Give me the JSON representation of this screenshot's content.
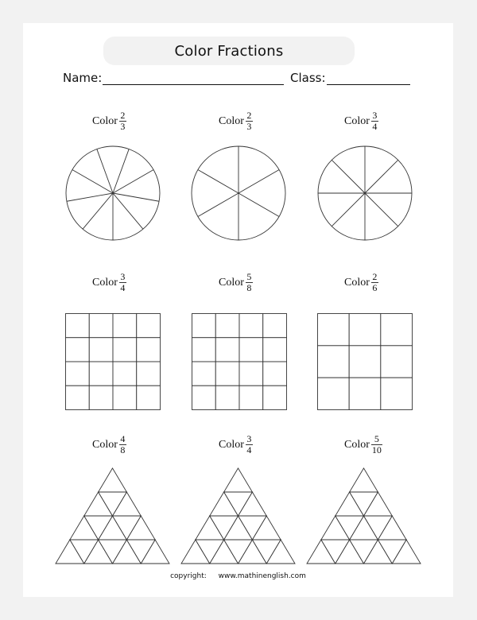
{
  "worksheet": {
    "title": "Color Fractions",
    "name_label": "Name:",
    "class_label": "Class:"
  },
  "problems": [
    {
      "label": "Color",
      "numerator": "2",
      "denominator": "3",
      "shape": "circle",
      "segments": 9
    },
    {
      "label": "Color",
      "numerator": "2",
      "denominator": "3",
      "shape": "circle",
      "segments": 6
    },
    {
      "label": "Color",
      "numerator": "3",
      "denominator": "4",
      "shape": "circle",
      "segments": 8
    },
    {
      "label": "Color",
      "numerator": "3",
      "denominator": "4",
      "shape": "grid",
      "rows": 4,
      "cols": 4
    },
    {
      "label": "Color",
      "numerator": "5",
      "denominator": "8",
      "shape": "grid",
      "rows": 4,
      "cols": 4
    },
    {
      "label": "Color",
      "numerator": "2",
      "denominator": "6",
      "shape": "grid",
      "rows": 3,
      "cols": 3
    },
    {
      "label": "Color",
      "numerator": "4",
      "denominator": "8",
      "shape": "triangle",
      "rows": 4
    },
    {
      "label": "Color",
      "numerator": "3",
      "denominator": "4",
      "shape": "triangle",
      "rows": 4
    },
    {
      "label": "Color",
      "numerator": "5",
      "denominator": "10",
      "shape": "triangle",
      "rows": 4
    }
  ],
  "footer": {
    "copyright_label": "copyright:",
    "website": "www.mathinenglish.com"
  },
  "colors": {
    "background": "#f2f2f2",
    "page": "#ffffff",
    "line": "#333333"
  }
}
